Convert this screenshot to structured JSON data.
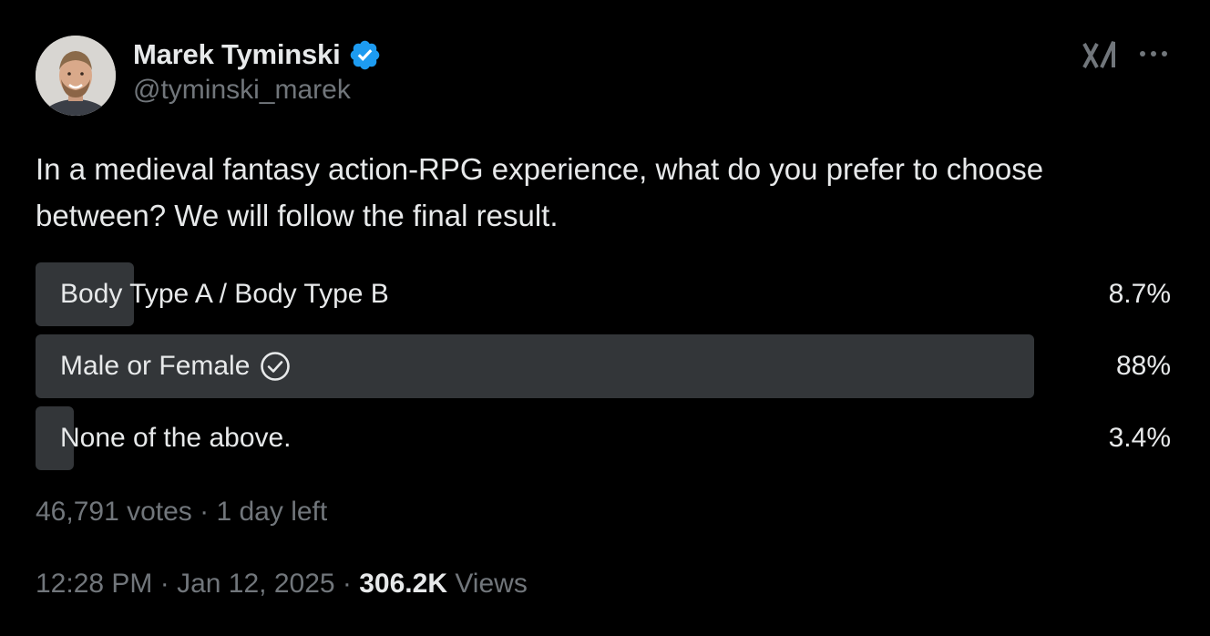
{
  "author": {
    "display_name": "Marek Tyminski",
    "handle": "@tyminski_marek",
    "verified": true
  },
  "icons": {
    "verified": "verified-badge-icon",
    "grok": "grok-icon",
    "more": "more-options-icon",
    "check": "check-circle-icon"
  },
  "colors": {
    "background": "#000000",
    "text_primary": "#e7e9ea",
    "text_secondary": "#71767b",
    "verified_blue": "#1d9bf0",
    "poll_bar": "#333639"
  },
  "tweet": {
    "text": "In a medieval fantasy action-RPG experience, what do you prefer to choose between? We will follow the final result."
  },
  "poll": {
    "options": [
      {
        "label": "Body Type A / Body Type B",
        "percent_text": "8.7%",
        "percent": 8.7,
        "winner": false
      },
      {
        "label": "Male or Female",
        "percent_text": "88%",
        "percent": 88,
        "winner": true
      },
      {
        "label": "None of the above.",
        "percent_text": "3.4%",
        "percent": 3.4,
        "winner": false
      }
    ],
    "votes": "46,791 votes",
    "separator": " · ",
    "time_left": "1 day left"
  },
  "meta": {
    "time": "12:28 PM",
    "separator": " · ",
    "date": "Jan 12, 2025",
    "views_count": "306.2K",
    "views_label": " Views"
  }
}
